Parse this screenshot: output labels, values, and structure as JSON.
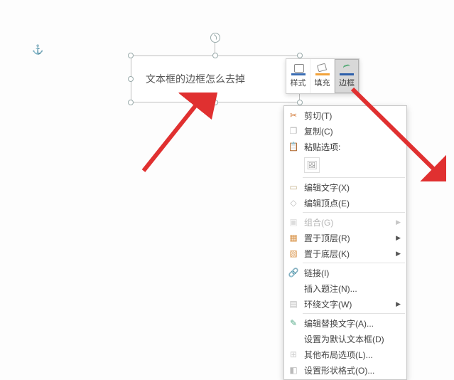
{
  "anchor_glyph": "⚓",
  "textbox": {
    "text": "文本框的边框怎么去掉"
  },
  "mini_toolbar": {
    "style_label": "样式",
    "fill_label": "填充",
    "border_label": "边框"
  },
  "menu": {
    "cut": "剪切(T)",
    "copy": "复制(C)",
    "paste_header": "粘贴选项:",
    "edit_text": "编辑文字(X)",
    "edit_points": "编辑顶点(E)",
    "group": "组合(G)",
    "bring_front": "置于顶层(R)",
    "send_back": "置于底层(K)",
    "hyperlink": "链接(I)",
    "insert_caption": "插入题注(N)...",
    "wrap_text": "环绕文字(W)",
    "alt_text": "编辑替换文字(A)...",
    "set_default": "设置为默认文本框(D)",
    "more_layout": "其他布局选项(L)...",
    "format_shape": "设置形状格式(O)..."
  }
}
